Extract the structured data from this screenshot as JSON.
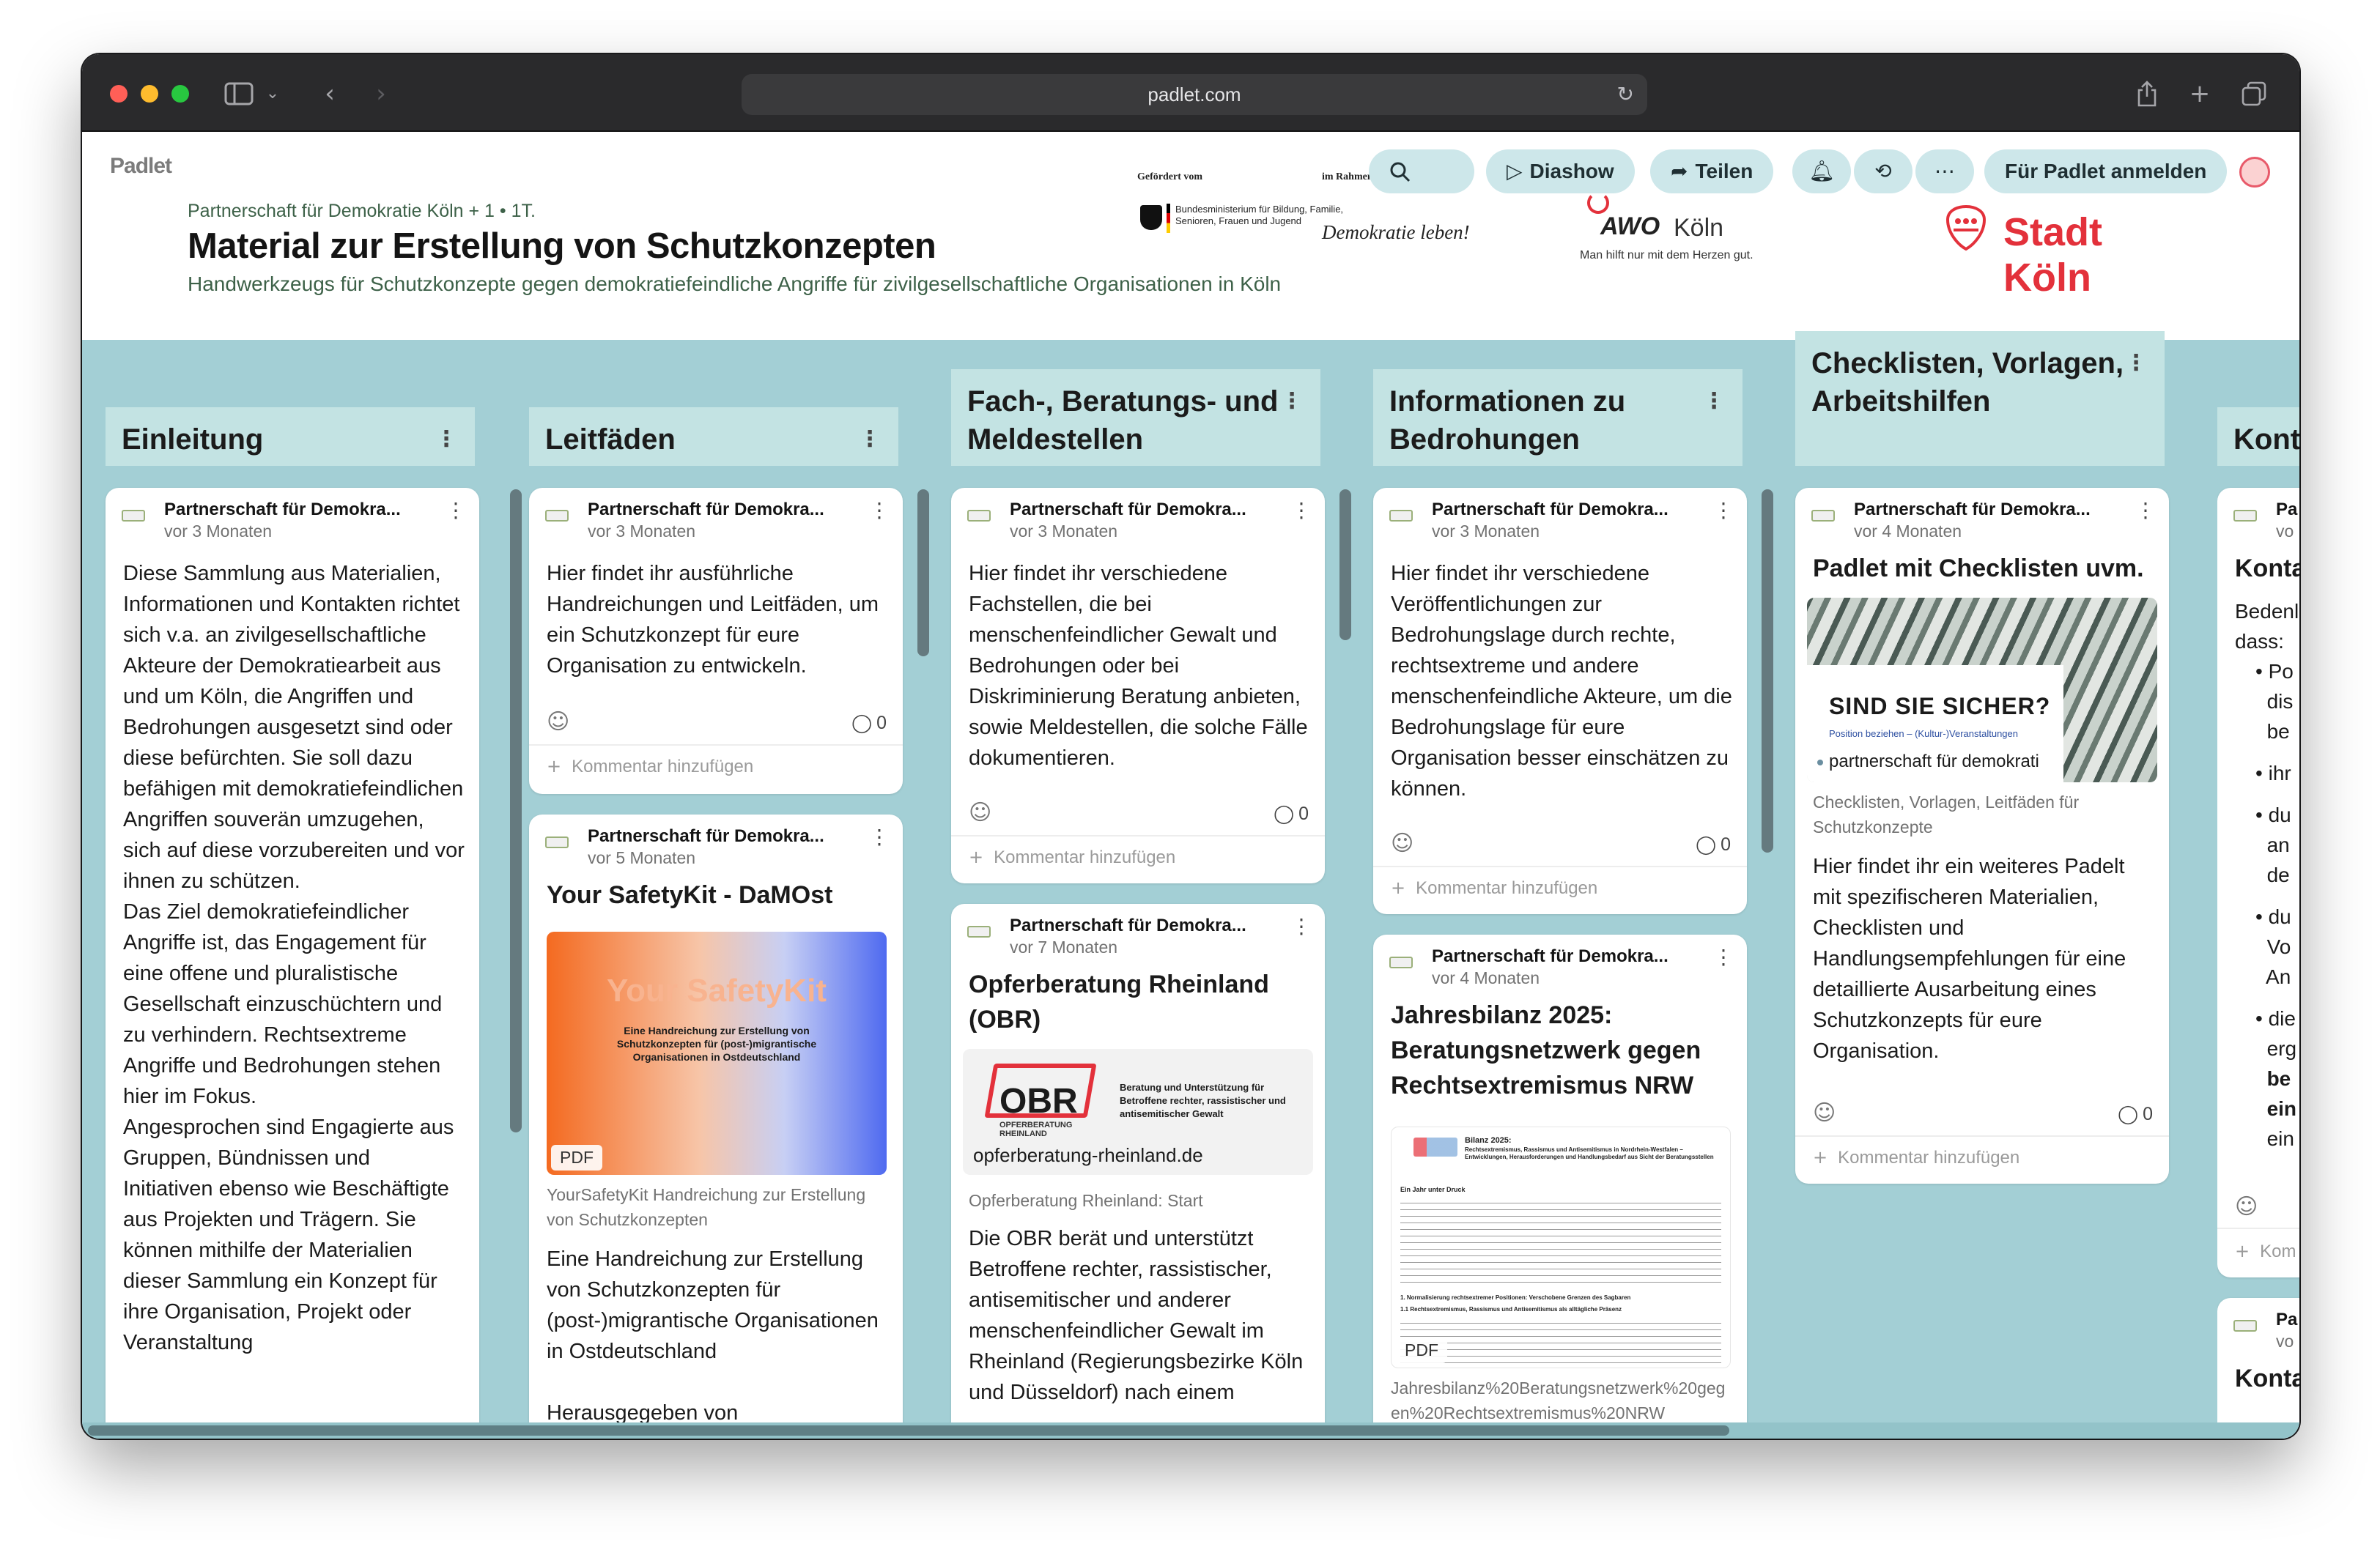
{
  "browser": {
    "url": "padlet.com"
  },
  "header": {
    "logo": "Padlet",
    "breadcrumb": "Partnerschaft für Demokratie Köln + 1 • 1T.",
    "title": "Material zur Erstellung von Schutzkonzepten",
    "subtitle": "Handwerkzeugs für Schutzkonzepte gegen demokratiefeindliche Angriffe für zivilgesellschaftliche Organisationen in Köln",
    "sponsors": {
      "gefoerdert": "Gefördert vom",
      "ministry": "Bundesministerium für Bildung, Familie, Senioren, Frauen und Jugend",
      "im_rahmen": "im Rahmen",
      "demokratie": "Demokratie leben!",
      "awo": "AWO",
      "awo_koeln": "Köln",
      "awo_tagline": "Man hilft nur mit dem Herzen gut.",
      "stadt": "Stadt Köln"
    },
    "actions": {
      "slideshow": "Diashow",
      "share": "Teilen",
      "login": "Für Padlet anmelden"
    }
  },
  "columns": [
    {
      "title": "Einleitung"
    },
    {
      "title": "Leitfäden"
    },
    {
      "title": "Fach-, Beratungs- und Meldestellen"
    },
    {
      "title": "Informationen zu Bedrohungen"
    },
    {
      "title": "Checklisten, Vorlagen, Arbeitshilfen"
    },
    {
      "title": "Kont"
    }
  ],
  "cards": {
    "einleitung": {
      "author": "Partnerschaft für Demokra...",
      "time": "vor 3 Monaten",
      "body": "Diese Sammlung aus Materialien, Informationen und Kontakten richtet sich v.a. an zivilgesellschaftliche Akteure der Demokratiearbeit aus und um Köln, die Angriffen und Bedrohungen ausgesetzt sind oder diese befürchten. Sie soll dazu befähigen mit demokratiefeindlichen Angriffen souverän umzugehen, sich auf diese vorzubereiten und vor ihnen zu schützen.",
      "body2": "Das Ziel demokratiefeindlicher Angriffe ist, das Engagement für eine offene und pluralistische Gesellschaft einzuschüchtern und zu verhindern. Rechtsextreme Angriffe und Bedrohungen stehen hier im Fokus.",
      "body3": "Angesprochen sind Engagierte aus Gruppen, Bündnissen und Initiativen ebenso wie Beschäftigte aus Projekten und Trägern. Sie können mithilfe der Materialien dieser Sammlung ein Konzept für ihre Organisation, Projekt oder Veranstaltung"
    },
    "leitfaeden1": {
      "author": "Partnerschaft für Demokra...",
      "time": "vor 3 Monaten",
      "body": "Hier findet ihr ausführliche Handreichungen und Leitfäden, um ein Schutzkonzept für eure Organisation zu entwickeln.",
      "comments": "0",
      "add_comment": "Kommentar hinzufügen"
    },
    "leitfaeden2": {
      "author": "Partnerschaft für Demokra...",
      "time": "vor 5 Monaten",
      "heading": "Your SafetyKit - DaMOst",
      "thumb_title": "Your SafetyKit",
      "thumb_sub": "Eine Handreichung zur Erstellung von Schutzkonzepten für (post-)migrantische Organisationen in Ostdeutschland",
      "badge": "PDF",
      "meta": "YourSafetyKit Handreichung zur Erstellung von Schutzkonzepten",
      "body": "Eine Handreichung zur Erstellung von Schutzkonzepten für (post-)migrantische Organisationen in Ostdeutschland",
      "body2": "Herausgegeben von"
    },
    "fach1": {
      "author": "Partnerschaft für Demokra...",
      "time": "vor 3 Monaten",
      "body": "Hier findet ihr verschiedene Fachstellen, die bei menschenfeindlicher Gewalt und Bedrohungen oder bei Diskriminierung Beratung anbieten, sowie Meldestellen, die solche Fälle dokumentieren.",
      "comments": "0",
      "add_comment": "Kommentar hinzufügen"
    },
    "fach2": {
      "author": "Partnerschaft für Demokra...",
      "time": "vor 7 Monaten",
      "heading": "Opferberatung Rheinland (OBR)",
      "obr_logo": "OBR",
      "obr_logo_sub": "OPFERBERATUNG RHEINLAND",
      "obr_claim": "Beratung und Unterstützung für Betroffene rechter, rassistischer und antisemitischer Gewalt",
      "link_domain": "opferberatung-rheinland.de",
      "meta": "Opferberatung Rheinland: Start",
      "body": "Die OBR berät und unterstützt Betroffene rechter, rassistischer, antisemitischer und anderer menschenfeindlicher Gewalt im Rheinland (Regierungsbezirke Köln und Düsseldorf) nach einem"
    },
    "info1": {
      "author": "Partnerschaft für Demokra...",
      "time": "vor 3 Monaten",
      "body": "Hier findet ihr verschiedene Veröffentlichungen zur Bedrohungslage durch rechte, rechtsextreme und andere menschenfeindliche Akteure, um die Bedrohungslage für eure Organisation besser einschätzen zu können.",
      "comments": "0",
      "add_comment": "Kommentar hinzufügen"
    },
    "info2": {
      "author": "Partnerschaft für Demokra...",
      "time": "vor 4 Monaten",
      "heading": "Jahresbilanz 2025: Beratungsnetzwerk gegen Rechtsextremismus NRW",
      "doc_title": "Bilanz 2025:",
      "doc_sub": "Rechtsextremismus, Rassismus und Antisemitismus in Nordrhein-Westfalen – Entwicklungen, Herausforderungen und Handlungsbedarf aus Sicht der Beratungsstellen",
      "doc_h1": "Ein Jahr unter Druck",
      "doc_h2": "1. Normalisierung rechtsextremer Positionen: Verschobene Grenzen des Sagbaren",
      "doc_h3": "1.1 Rechtsextremismus, Rassismus und Antisemitismus als alltägliche Präsenz",
      "badge": "PDF",
      "meta": "Jahresbilanz%20Beratungsnetzwerk%20gegen%20Rechtsextremismus%20NRW"
    },
    "check1": {
      "author": "Partnerschaft für Demokra...",
      "time": "vor 4 Monaten",
      "heading": "Padlet mit Checklisten uvm.",
      "thumb_title": "SIND SIE SICHER?",
      "thumb_sub": "Position beziehen – (Kultur-)Veranstaltungen",
      "thumb_author": "partnerschaft für demokrati",
      "meta": "Checklisten, Vorlagen, Leitfäden für Schutzkonzepte",
      "body": "Hier findet ihr ein weiteres Padelt mit spezifischeren Materialien, Checklisten und Handlungsempfehlungen für eine detaillierte Ausarbeitung eines Schutzkonzepts für eure Organisation.",
      "comments": "0",
      "add_comment": "Kommentar hinzufügen"
    },
    "kont1": {
      "author": "Pa",
      "time": "vo",
      "heading": "Konta",
      "body": "Bedenl",
      "body2": "dass:",
      "bullets": [
        "Po",
        "dis",
        "be",
        "ihr",
        "du",
        "an",
        "de",
        "du",
        "Vo",
        "An",
        "die",
        "erg",
        "be",
        "ein",
        "ein"
      ],
      "add_comment": "Kom"
    },
    "kont2": {
      "author": "Pa",
      "time": "vo",
      "heading": "Konta"
    }
  },
  "colors": {
    "board": "#a3cfd5",
    "column_header": "#c3e3e3",
    "accent_red": "#e3313b"
  }
}
